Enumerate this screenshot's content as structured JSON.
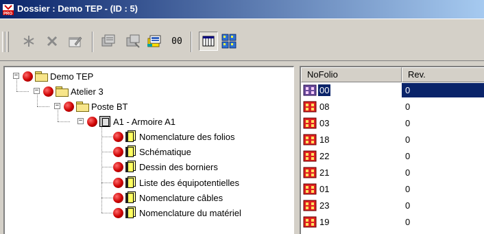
{
  "window": {
    "title": "Dossier : Demo TEP - (ID : 5)",
    "title_bg": "#0a246a",
    "icon": "app-pro-icon"
  },
  "toolbar": {
    "buttons": [
      {
        "name": "new-icon",
        "label": ""
      },
      {
        "name": "delete-icon",
        "label": ""
      },
      {
        "name": "properties-icon",
        "label": ""
      },
      {
        "name": "copy-folio-icon",
        "label": ""
      },
      {
        "name": "paste-folio-icon",
        "label": ""
      },
      {
        "name": "edit-folio-icon",
        "label": ""
      },
      {
        "name": "link-icon",
        "label": "00"
      },
      {
        "name": "list-view-icon",
        "label": ""
      },
      {
        "name": "grid-view-icon",
        "label": ""
      }
    ]
  },
  "tree": {
    "nodes": [
      {
        "label": "Demo TEP",
        "icon": "folder-icon",
        "level": 0,
        "expander": "−"
      },
      {
        "label": "Atelier 3",
        "icon": "folder-icon",
        "level": 1,
        "expander": "−"
      },
      {
        "label": "Poste BT",
        "icon": "folder-icon",
        "level": 2,
        "expander": "−"
      },
      {
        "label": "A1 - Armoire A1",
        "icon": "cabinet-icon",
        "level": 3,
        "expander": "−"
      },
      {
        "label": "Nomenclature des folios",
        "icon": "book-icon",
        "level": 4
      },
      {
        "label": "Schématique",
        "icon": "book-icon",
        "level": 4
      },
      {
        "label": "Dessin des borniers",
        "icon": "book-icon",
        "level": 4
      },
      {
        "label": "Liste des équipotentielles",
        "icon": "book-icon",
        "level": 4
      },
      {
        "label": "Nomenclature câbles",
        "icon": "book-icon",
        "level": 4
      },
      {
        "label": "Nomenclature du matériel",
        "icon": "book-icon",
        "level": 4
      }
    ]
  },
  "list": {
    "columns": [
      "NoFolio",
      "Rev."
    ],
    "rows": [
      {
        "folio": "00",
        "rev": "0",
        "selected": true
      },
      {
        "folio": "08",
        "rev": "0"
      },
      {
        "folio": "03",
        "rev": "0"
      },
      {
        "folio": "18",
        "rev": "0"
      },
      {
        "folio": "22",
        "rev": "0"
      },
      {
        "folio": "21",
        "rev": "0"
      },
      {
        "folio": "01",
        "rev": "0"
      },
      {
        "folio": "23",
        "rev": "0"
      },
      {
        "folio": "19",
        "rev": "0"
      }
    ],
    "selection_color": "#0a246a"
  }
}
